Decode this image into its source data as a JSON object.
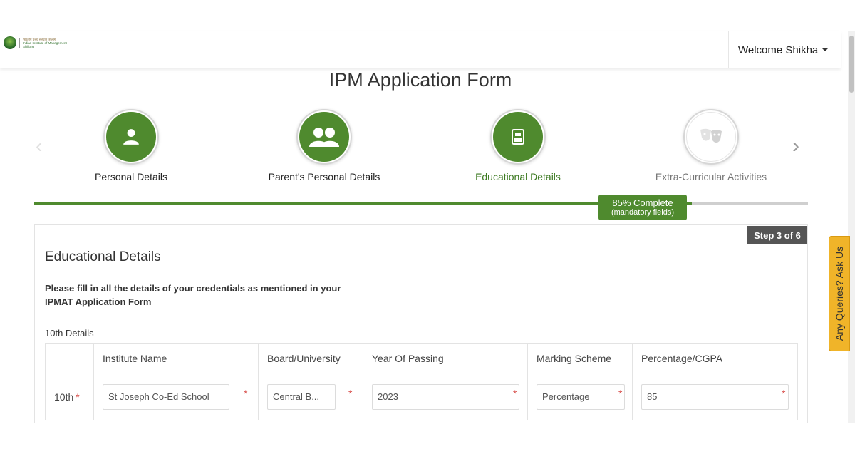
{
  "header": {
    "logo_lines": [
      "भारतीय प्रबंध संस्थान शिलांग",
      "Indian Institute of Management",
      "Shillong"
    ],
    "welcome": "Welcome Shikha"
  },
  "page_title": "IPM Application Form",
  "stepper": {
    "steps": [
      {
        "label": "Personal Details",
        "icon": "person-icon",
        "state": "done"
      },
      {
        "label": "Parent's Personal Details",
        "icon": "parents-icon",
        "state": "done"
      },
      {
        "label": "Educational Details",
        "icon": "document-icon",
        "state": "current"
      },
      {
        "label": "Extra-Curricular Activities",
        "icon": "theater-masks-icon",
        "state": "pending"
      }
    ],
    "progress_percent": 85,
    "progress_label": "85% Complete",
    "progress_sub": "(mandatory fields)"
  },
  "form": {
    "step_tag": "Step 3 of 6",
    "heading": "Educational Details",
    "instruction": "Please fill in all the details of your credentials as mentioned in your IPMAT Application Form",
    "section_label": "10th Details",
    "columns": [
      "Institute Name",
      "Board/University",
      "Year Of Passing",
      "Marking Scheme",
      "Percentage/CGPA"
    ],
    "row": {
      "label": "10th",
      "institute": "St Joseph Co-Ed School",
      "board": "Central B...",
      "year": "2023",
      "scheme": "Percentage",
      "percentage": "85"
    }
  },
  "side_tab": "Any Queries? Ask Us",
  "colors": {
    "brand_green": "#4f8a2e",
    "ask_tab": "#f0b429",
    "required": "#d9534f"
  }
}
